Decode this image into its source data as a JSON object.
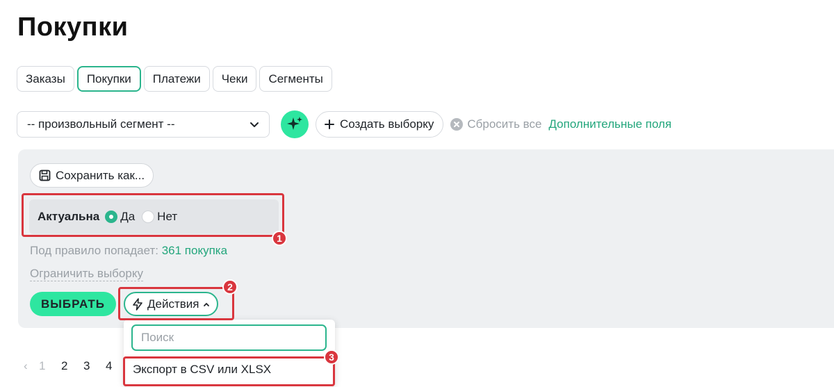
{
  "page": {
    "title": "Покупки"
  },
  "tabs": [
    {
      "label": "Заказы",
      "active": false
    },
    {
      "label": "Покупки",
      "active": true
    },
    {
      "label": "Платежи",
      "active": false
    },
    {
      "label": "Чеки",
      "active": false
    },
    {
      "label": "Сегменты",
      "active": false
    }
  ],
  "toolbar": {
    "segment_value": "-- произвольный сегмент --",
    "create_label": "Создать выборку",
    "reset_label": "Сбросить все",
    "extra_fields_label": "Дополнительные поля"
  },
  "filter": {
    "save_label": "Сохранить как...",
    "rule_label": "Актуальна",
    "options": [
      "Да",
      "Нет"
    ],
    "selected": "Да",
    "count_prefix": "Под правило попадает:",
    "count_value": "361 покупка",
    "limit_label": "Ограничить выборку",
    "select_label": "ВЫБРАТЬ",
    "actions_label": "Действия"
  },
  "dropdown": {
    "search_placeholder": "Поиск",
    "items": [
      "Экспорт в CSV или XLSX"
    ]
  },
  "pagination": {
    "prev": "‹",
    "pages": [
      "1",
      "2",
      "3",
      "4"
    ],
    "current": "1"
  },
  "annotations": [
    "1",
    "2",
    "3"
  ],
  "colors": {
    "accent": "#2bb58d",
    "accent_bright": "#2ee6a0",
    "highlight": "#d9363e",
    "panel_bg": "#eef0f2"
  }
}
